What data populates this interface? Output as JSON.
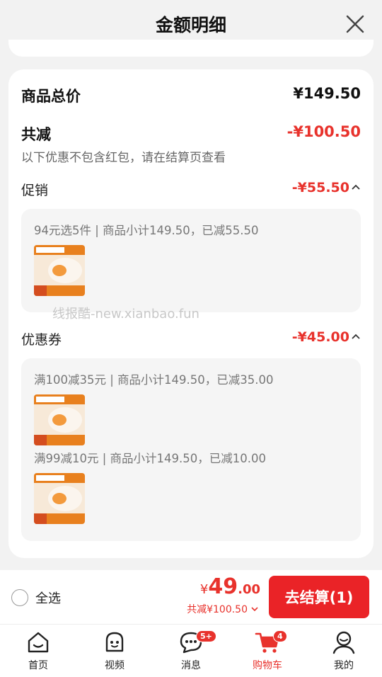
{
  "header": {
    "title": "金额明细"
  },
  "summary": {
    "total_label": "商品总价",
    "total_value": "¥149.50",
    "reduce_label": "共减",
    "reduce_value": "-¥100.50",
    "note": "以下优惠不包含红包，请在结算页查看"
  },
  "promotion": {
    "label": "促销",
    "value": "-¥55.50",
    "items": [
      {
        "text": "94元选5件 | 商品小计149.50，已减55.50"
      }
    ]
  },
  "watermark": "线报酷-new.xianbao.fun",
  "coupon": {
    "label": "优惠券",
    "value": "-¥45.00",
    "items": [
      {
        "text": "满100减35元 | 商品小计149.50，已减35.00"
      },
      {
        "text": "满99减10元 | 商品小计149.50，已减10.00"
      }
    ]
  },
  "thumb": {
    "banner": "任选5件仅需69元",
    "tag": "13"
  },
  "bottom": {
    "select_all": "全选",
    "price_yen": "¥",
    "price_int": "49",
    "price_dec": ".00",
    "discount": "共减¥100.50",
    "checkout": "去结算(1)"
  },
  "tabs": [
    {
      "label": "首页",
      "icon": "home-icon"
    },
    {
      "label": "视频",
      "icon": "video-icon"
    },
    {
      "label": "消息",
      "icon": "message-icon",
      "badge": "5+"
    },
    {
      "label": "购物车",
      "icon": "cart-icon",
      "badge": "4",
      "active": true
    },
    {
      "label": "我的",
      "icon": "profile-icon"
    }
  ],
  "colors": {
    "accent": "#e8322c",
    "background": "#f2f2f2"
  }
}
